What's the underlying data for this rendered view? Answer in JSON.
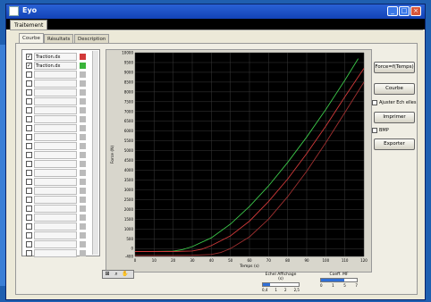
{
  "window": {
    "title": "Eyo"
  },
  "outer_tab": {
    "label": "Traitement"
  },
  "tabs": [
    {
      "label": "Courbe",
      "active": true
    },
    {
      "label": "Résultats",
      "active": false
    },
    {
      "label": "Description",
      "active": false
    }
  ],
  "list_items": [
    {
      "label": "Traction.dx",
      "checked": true,
      "color": "#d23a3a"
    },
    {
      "label": "Traction.dx",
      "checked": true,
      "color": "#3ab43a"
    },
    {
      "label": "",
      "checked": false,
      "color": "#bbbbbb"
    },
    {
      "label": "",
      "checked": false,
      "color": "#bbbbbb"
    },
    {
      "label": "",
      "checked": false,
      "color": "#bbbbbb"
    },
    {
      "label": "",
      "checked": false,
      "color": "#bbbbbb"
    },
    {
      "label": "",
      "checked": false,
      "color": "#bbbbbb"
    },
    {
      "label": "",
      "checked": false,
      "color": "#bbbbbb"
    },
    {
      "label": "",
      "checked": false,
      "color": "#bbbbbb"
    },
    {
      "label": "",
      "checked": false,
      "color": "#bbbbbb"
    },
    {
      "label": "",
      "checked": false,
      "color": "#bbbbbb"
    },
    {
      "label": "",
      "checked": false,
      "color": "#bbbbbb"
    },
    {
      "label": "",
      "checked": false,
      "color": "#bbbbbb"
    },
    {
      "label": "",
      "checked": false,
      "color": "#bbbbbb"
    },
    {
      "label": "",
      "checked": false,
      "color": "#bbbbbb"
    },
    {
      "label": "",
      "checked": false,
      "color": "#bbbbbb"
    },
    {
      "label": "",
      "checked": false,
      "color": "#bbbbbb"
    },
    {
      "label": "",
      "checked": false,
      "color": "#bbbbbb"
    },
    {
      "label": "",
      "checked": false,
      "color": "#bbbbbb"
    },
    {
      "label": "",
      "checked": false,
      "color": "#bbbbbb"
    },
    {
      "label": "",
      "checked": false,
      "color": "#bbbbbb"
    },
    {
      "label": "",
      "checked": false,
      "color": "#bbbbbb"
    },
    {
      "label": "",
      "checked": false,
      "color": "#bbbbbb"
    }
  ],
  "right_panel": {
    "mode_select": "Force=f(Temps)",
    "courbe_button": "Courbe",
    "ajuster_label": "Ajuster Ech elles",
    "imprimer_button": "Imprimer",
    "bmp_label": "BMP",
    "exporter_button": "Exporter"
  },
  "sliders": [
    {
      "label": "Echel Affichage (s)",
      "value": 0.2,
      "ticks": [
        "0,4",
        "1",
        "2",
        "2,5"
      ]
    },
    {
      "label": "Coeff. MF",
      "value": 0.65,
      "ticks": [
        "0",
        "1",
        "5",
        "7"
      ]
    }
  ],
  "toolbox": {
    "icons": [
      "zoom-icon",
      "magnify-icon",
      "pan-icon"
    ]
  },
  "chart_data": {
    "type": "line",
    "xlabel": "Temps (s)",
    "ylabel": "Force (N)",
    "xlim": [
      0,
      120
    ],
    "ylim": [
      -400,
      10000
    ],
    "x_ticks": [
      0,
      10,
      20,
      30,
      40,
      50,
      60,
      70,
      80,
      90,
      100,
      110,
      120
    ],
    "y_ticks": [
      -400,
      0,
      500,
      1000,
      1500,
      2000,
      2500,
      3000,
      3500,
      4000,
      4500,
      5000,
      5500,
      6000,
      6500,
      7000,
      7500,
      8000,
      8500,
      9000,
      9500,
      10000
    ],
    "grid": true,
    "series": [
      {
        "color": "#3cc84a",
        "x": [
          0,
          10,
          20,
          25,
          30,
          40,
          50,
          60,
          70,
          80,
          90,
          100,
          110,
          117
        ],
        "y": [
          -150,
          -150,
          -130,
          -50,
          100,
          550,
          1250,
          2150,
          3200,
          4400,
          5700,
          7100,
          8600,
          9700
        ]
      },
      {
        "color": "#d23a3a",
        "x": [
          0,
          10,
          20,
          30,
          35,
          40,
          50,
          60,
          70,
          80,
          90,
          100,
          110,
          120
        ],
        "y": [
          -150,
          -150,
          -150,
          -120,
          -30,
          150,
          650,
          1400,
          2400,
          3550,
          4850,
          6250,
          7750,
          9200
        ]
      },
      {
        "color": "#a03030",
        "x": [
          0,
          10,
          20,
          30,
          40,
          45,
          50,
          60,
          70,
          80,
          90,
          100,
          110,
          120
        ],
        "y": [
          -350,
          -350,
          -350,
          -340,
          -300,
          -200,
          0,
          600,
          1500,
          2650,
          3950,
          5400,
          6950,
          8500
        ]
      }
    ]
  }
}
